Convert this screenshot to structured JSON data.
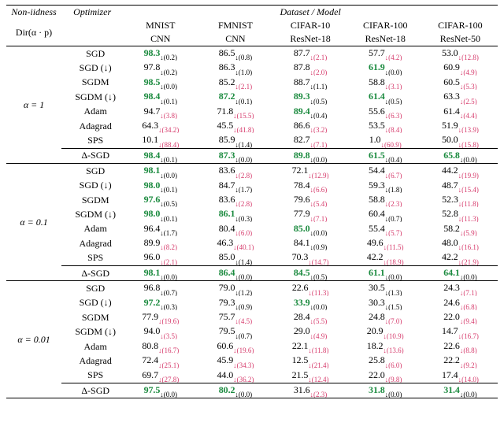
{
  "header": {
    "non_iidness": "Non-iidness",
    "optimizer": "Optimizer",
    "dataset_model": "Dataset / Model",
    "dir_label": "Dir(α · p)",
    "columns": [
      {
        "top": "MNIST",
        "bot": "CNN"
      },
      {
        "top": "FMNIST",
        "bot": "CNN"
      },
      {
        "top": "CIFAR-10",
        "bot": "ResNet-18"
      },
      {
        "top": "CIFAR-100",
        "bot": "ResNet-18"
      },
      {
        "top": "CIFAR-100",
        "bot": "ResNet-50"
      }
    ]
  },
  "blocks": [
    {
      "label": "α = 1",
      "rows": [
        {
          "opt": "SGD",
          "cells": [
            {
              "v": "98.3",
              "g": true,
              "s": "↓(0.2)",
              "r": false
            },
            {
              "v": "86.5",
              "s": "↓(0.8)",
              "r": false
            },
            {
              "v": "87.7",
              "s": "↓(2.1)",
              "r": true
            },
            {
              "v": "57.7",
              "s": "↓(4.2)",
              "r": true
            },
            {
              "v": "53.0",
              "s": "↓(12.8)",
              "r": true
            }
          ]
        },
        {
          "opt": "SGD (↓)",
          "cells": [
            {
              "v": "97.8",
              "s": "↓(0.2)",
              "r": false
            },
            {
              "v": "86.3",
              "s": "↓(1.0)",
              "r": false
            },
            {
              "v": "87.8",
              "s": "↓(2.0)",
              "r": true
            },
            {
              "v": "61.9",
              "g": true,
              "s": "↓(0.0)",
              "r": false
            },
            {
              "v": "60.9",
              "s": "↓(4.9)",
              "r": true
            }
          ]
        },
        {
          "opt": "SGDM",
          "cells": [
            {
              "v": "98.5",
              "g": true,
              "s": "↓(0.0)",
              "r": false
            },
            {
              "v": "85.2",
              "s": "↓(2.1)",
              "r": true
            },
            {
              "v": "88.7",
              "s": "↓(1.1)",
              "r": false
            },
            {
              "v": "58.8",
              "s": "↓(3.1)",
              "r": true
            },
            {
              "v": "60.5",
              "s": "↓(5.3)",
              "r": true
            }
          ]
        },
        {
          "opt": "SGDM (↓)",
          "cells": [
            {
              "v": "98.4",
              "g": true,
              "s": "↓(0.1)",
              "r": false
            },
            {
              "v": "87.2",
              "g": true,
              "s": "↓(0.1)",
              "r": false
            },
            {
              "v": "89.3",
              "g": true,
              "s": "↓(0.5)",
              "r": false
            },
            {
              "v": "61.4",
              "g": true,
              "s": "↓(0.5)",
              "r": false
            },
            {
              "v": "63.3",
              "s": "↓(2.5)",
              "r": true
            }
          ]
        },
        {
          "opt": "Adam",
          "cells": [
            {
              "v": "94.7",
              "s": "↓(3.8)",
              "r": true
            },
            {
              "v": "71.8",
              "s": "↓(15.5)",
              "r": true
            },
            {
              "v": "89.4",
              "g": true,
              "s": "↓(0.4)",
              "r": false
            },
            {
              "v": "55.6",
              "s": "↓(6.3)",
              "r": true
            },
            {
              "v": "61.4",
              "s": "↓(4.4)",
              "r": true
            }
          ]
        },
        {
          "opt": "Adagrad",
          "cells": [
            {
              "v": "64.3",
              "s": "↓(34.2)",
              "r": true
            },
            {
              "v": "45.5",
              "s": "↓(41.8)",
              "r": true
            },
            {
              "v": "86.6",
              "s": "↓(3.2)",
              "r": true
            },
            {
              "v": "53.5",
              "s": "↓(8.4)",
              "r": true
            },
            {
              "v": "51.9",
              "s": "↓(13.9)",
              "r": true
            }
          ]
        },
        {
          "opt": "SPS",
          "cells": [
            {
              "v": "10.1",
              "s": "↓(88.4)",
              "r": true
            },
            {
              "v": "85.9",
              "s": "↓(1.4)",
              "r": false
            },
            {
              "v": "82.7",
              "s": "↓(7.1)",
              "r": true
            },
            {
              "v": "1.0",
              "s": "↓(60.9)",
              "r": true
            },
            {
              "v": "50.0",
              "s": "↓(15.8)",
              "r": true
            }
          ]
        }
      ],
      "delta": {
        "opt": "Δ-SGD",
        "cells": [
          {
            "v": "98.4",
            "g": true,
            "s": "↓(0.1)",
            "r": false
          },
          {
            "v": "87.3",
            "g": true,
            "s": "↓(0.0)",
            "r": false
          },
          {
            "v": "89.8",
            "g": true,
            "s": "↓(0.0)",
            "r": false
          },
          {
            "v": "61.5",
            "g": true,
            "s": "↓(0.4)",
            "r": false
          },
          {
            "v": "65.8",
            "g": true,
            "s": "↓(0.0)",
            "r": false
          }
        ]
      }
    },
    {
      "label": "α = 0.1",
      "rows": [
        {
          "opt": "SGD",
          "cells": [
            {
              "v": "98.1",
              "g": true,
              "s": "↓(0.0)",
              "r": false
            },
            {
              "v": "83.6",
              "s": "↓(2.8)",
              "r": true
            },
            {
              "v": "72.1",
              "s": "↓(12.9)",
              "r": true
            },
            {
              "v": "54.4",
              "s": "↓(6.7)",
              "r": true
            },
            {
              "v": "44.2",
              "s": "↓(19.9)",
              "r": true
            }
          ]
        },
        {
          "opt": "SGD (↓)",
          "cells": [
            {
              "v": "98.0",
              "g": true,
              "s": "↓(0.1)",
              "r": false
            },
            {
              "v": "84.7",
              "s": "↓(1.7)",
              "r": false
            },
            {
              "v": "78.4",
              "s": "↓(6.6)",
              "r": true
            },
            {
              "v": "59.3",
              "s": "↓(1.8)",
              "r": false
            },
            {
              "v": "48.7",
              "s": "↓(15.4)",
              "r": true
            }
          ]
        },
        {
          "opt": "SGDM",
          "cells": [
            {
              "v": "97.6",
              "g": true,
              "s": "↓(0.5)",
              "r": false
            },
            {
              "v": "83.6",
              "s": "↓(2.8)",
              "r": true
            },
            {
              "v": "79.6",
              "s": "↓(5.4)",
              "r": true
            },
            {
              "v": "58.8",
              "s": "↓(2.3)",
              "r": true
            },
            {
              "v": "52.3",
              "s": "↓(11.8)",
              "r": true
            }
          ]
        },
        {
          "opt": "SGDM (↓)",
          "cells": [
            {
              "v": "98.0",
              "g": true,
              "s": "↓(0.1)",
              "r": false
            },
            {
              "v": "86.1",
              "g": true,
              "s": "↓(0.3)",
              "r": false
            },
            {
              "v": "77.9",
              "s": "↓(7.1)",
              "r": true
            },
            {
              "v": "60.4",
              "s": "↓(0.7)",
              "r": false
            },
            {
              "v": "52.8",
              "s": "↓(11.3)",
              "r": true
            }
          ]
        },
        {
          "opt": "Adam",
          "cells": [
            {
              "v": "96.4",
              "s": "↓(1.7)",
              "r": false
            },
            {
              "v": "80.4",
              "s": "↓(6.0)",
              "r": true
            },
            {
              "v": "85.0",
              "g": true,
              "s": "↓(0.0)",
              "r": false
            },
            {
              "v": "55.4",
              "s": "↓(5.7)",
              "r": true
            },
            {
              "v": "58.2",
              "s": "↓(5.9)",
              "r": true
            }
          ]
        },
        {
          "opt": "Adagrad",
          "cells": [
            {
              "v": "89.9",
              "s": "↓(8.2)",
              "r": true
            },
            {
              "v": "46.3",
              "s": "↓(40.1)",
              "r": true
            },
            {
              "v": "84.1",
              "s": "↓(0.9)",
              "r": false
            },
            {
              "v": "49.6",
              "s": "↓(11.5)",
              "r": true
            },
            {
              "v": "48.0",
              "s": "↓(16.1)",
              "r": true
            }
          ]
        },
        {
          "opt": "SPS",
          "cells": [
            {
              "v": "96.0",
              "s": "↓(2.1)",
              "r": true
            },
            {
              "v": "85.0",
              "s": "↓(1.4)",
              "r": false
            },
            {
              "v": "70.3",
              "s": "↓(14.7)",
              "r": true
            },
            {
              "v": "42.2",
              "s": "↓(18.9)",
              "r": true
            },
            {
              "v": "42.2",
              "s": "↓(21.9)",
              "r": true
            }
          ]
        }
      ],
      "delta": {
        "opt": "Δ-SGD",
        "cells": [
          {
            "v": "98.1",
            "g": true,
            "s": "↓(0.0)",
            "r": false
          },
          {
            "v": "86.4",
            "g": true,
            "s": "↓(0.0)",
            "r": false
          },
          {
            "v": "84.5",
            "g": true,
            "s": "↓(0.5)",
            "r": false
          },
          {
            "v": "61.1",
            "g": true,
            "s": "↓(0.0)",
            "r": false
          },
          {
            "v": "64.1",
            "g": true,
            "s": "↓(0.0)",
            "r": false
          }
        ]
      }
    },
    {
      "label": "α = 0.01",
      "rows": [
        {
          "opt": "SGD",
          "cells": [
            {
              "v": "96.8",
              "s": "↓(0.7)",
              "r": false
            },
            {
              "v": "79.0",
              "s": "↓(1.2)",
              "r": false
            },
            {
              "v": "22.6",
              "s": "↓(11.3)",
              "r": true
            },
            {
              "v": "30.5",
              "s": "↓(1.3)",
              "r": false
            },
            {
              "v": "24.3",
              "s": "↓(7.1)",
              "r": true
            }
          ]
        },
        {
          "opt": "SGD (↓)",
          "cells": [
            {
              "v": "97.2",
              "g": true,
              "s": "↓(0.3)",
              "r": false
            },
            {
              "v": "79.3",
              "s": "↓(0.9)",
              "r": false
            },
            {
              "v": "33.9",
              "g": true,
              "s": "↓(0.0)",
              "r": false
            },
            {
              "v": "30.3",
              "s": "↓(1.5)",
              "r": false
            },
            {
              "v": "24.6",
              "s": "↓(6.8)",
              "r": true
            }
          ]
        },
        {
          "opt": "SGDM",
          "cells": [
            {
              "v": "77.9",
              "s": "↓(19.6)",
              "r": true
            },
            {
              "v": "75.7",
              "s": "↓(4.5)",
              "r": true
            },
            {
              "v": "28.4",
              "s": "↓(5.5)",
              "r": true
            },
            {
              "v": "24.8",
              "s": "↓(7.0)",
              "r": true
            },
            {
              "v": "22.0",
              "s": "↓(9.4)",
              "r": true
            }
          ]
        },
        {
          "opt": "SGDM (↓)",
          "cells": [
            {
              "v": "94.0",
              "s": "↓(3.5)",
              "r": true
            },
            {
              "v": "79.5",
              "s": "↓(0.7)",
              "r": false
            },
            {
              "v": "29.0",
              "s": "↓(4.9)",
              "r": true
            },
            {
              "v": "20.9",
              "s": "↓(10.9)",
              "r": true
            },
            {
              "v": "14.7",
              "s": "↓(16.7)",
              "r": true
            }
          ]
        },
        {
          "opt": "Adam",
          "cells": [
            {
              "v": "80.8",
              "s": "↓(16.7)",
              "r": true
            },
            {
              "v": "60.6",
              "s": "↓(19.6)",
              "r": true
            },
            {
              "v": "22.1",
              "s": "↓(11.8)",
              "r": true
            },
            {
              "v": "18.2",
              "s": "↓(13.6)",
              "r": true
            },
            {
              "v": "22.6",
              "s": "↓(8.8)",
              "r": true
            }
          ]
        },
        {
          "opt": "Adagrad",
          "cells": [
            {
              "v": "72.4",
              "s": "↓(25.1)",
              "r": true
            },
            {
              "v": "45.9",
              "s": "↓(34.3)",
              "r": true
            },
            {
              "v": "12.5",
              "s": "↓(21.4)",
              "r": true
            },
            {
              "v": "25.8",
              "s": "↓(6.0)",
              "r": true
            },
            {
              "v": "22.2",
              "s": "↓(9.2)",
              "r": true
            }
          ]
        },
        {
          "opt": "SPS",
          "cells": [
            {
              "v": "69.7",
              "s": "↓(27.8)",
              "r": true
            },
            {
              "v": "44.0",
              "s": "↓(36.2)",
              "r": true
            },
            {
              "v": "21.5",
              "s": "↓(12.4)",
              "r": true
            },
            {
              "v": "22.0",
              "s": "↓(9.8)",
              "r": true
            },
            {
              "v": "17.4",
              "s": "↓(14.0)",
              "r": true
            }
          ]
        }
      ],
      "delta": {
        "opt": "Δ-SGD",
        "cells": [
          {
            "v": "97.5",
            "g": true,
            "s": "↓(0.0)",
            "r": false
          },
          {
            "v": "80.2",
            "g": true,
            "s": "↓(0.0)",
            "r": false
          },
          {
            "v": "31.6",
            "s": "↓(2.3)",
            "r": true
          },
          {
            "v": "31.8",
            "g": true,
            "s": "↓(0.0)",
            "r": false
          },
          {
            "v": "31.4",
            "g": true,
            "s": "↓(0.0)",
            "r": false
          }
        ]
      }
    }
  ]
}
